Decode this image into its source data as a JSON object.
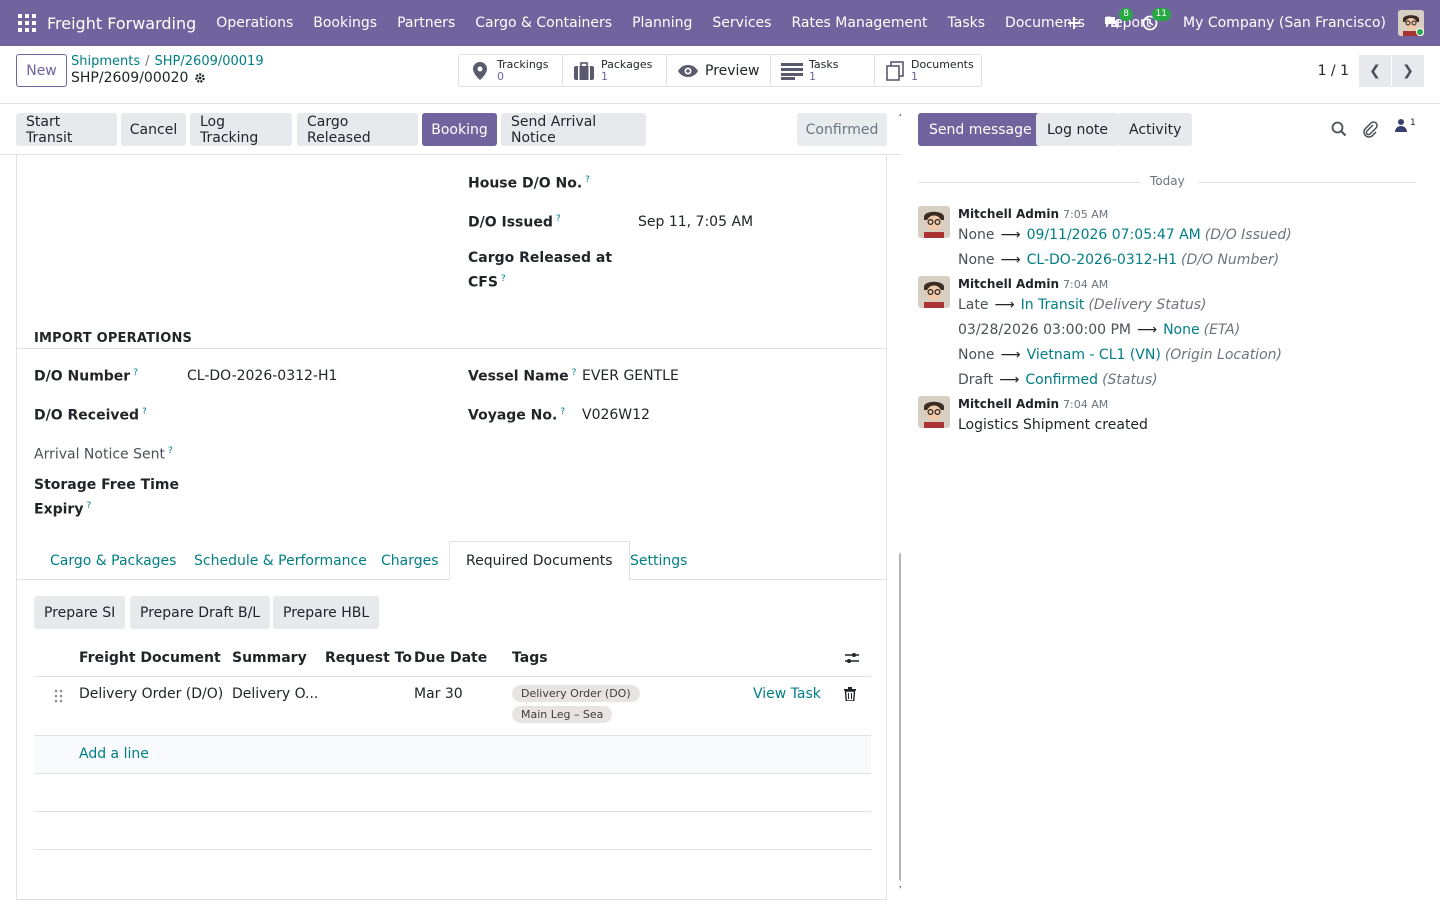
{
  "topbar": {
    "brand": "Freight Forwarding",
    "menu": [
      "Operations",
      "Bookings",
      "Partners",
      "Cargo & Containers",
      "Planning",
      "Services",
      "Rates Management",
      "Tasks",
      "Documents",
      "Report"
    ],
    "messages_count": "8",
    "activities_count": "11",
    "company": "My Company (San Francisco)"
  },
  "control": {
    "new_label": "New",
    "breadcrumb_parent": "Shipments",
    "breadcrumb_sep": "/",
    "breadcrumb_prev": "SHP/2609/00019",
    "current": "SHP/2609/00020",
    "smart_buttons": [
      {
        "label": "Trackings",
        "count": "0"
      },
      {
        "label": "Packages",
        "count": "1"
      },
      {
        "label": "Preview",
        "count": ""
      },
      {
        "label": "Tasks",
        "count": "1"
      },
      {
        "label": "Documents",
        "count": "1"
      }
    ],
    "pager": "1 / 1"
  },
  "statusbar": {
    "buttons": [
      "Start Transit",
      "Cancel",
      "Log Tracking",
      "Cargo Released",
      "Booking",
      "Send Arrival Notice"
    ],
    "status": "Confirmed"
  },
  "form": {
    "house_do_label": "House D/O No.",
    "do_issued_label": "D/O Issued",
    "do_issued_value": "Sep 11, 7:05 AM",
    "cargo_released_label_1": "Cargo Released at",
    "cargo_released_label_2": "CFS",
    "import_ops_title": "IMPORT OPERATIONS",
    "do_number_label": "D/O Number",
    "do_number_value": "CL-DO-2026-0312-H1",
    "do_received_label": "D/O Received",
    "arrival_notice_label": "Arrival Notice Sent",
    "storage_label_1": "Storage Free Time",
    "storage_label_2": "Expiry",
    "vessel_label": "Vessel Name",
    "vessel_value": "EVER GENTLE",
    "voyage_label": "Voyage No.",
    "voyage_value": "V026W12",
    "help": "?"
  },
  "tabs": [
    "Cargo & Packages",
    "Schedule & Performance",
    "Charges",
    "Required Documents",
    "Settings"
  ],
  "doc_buttons": [
    "Prepare SI",
    "Prepare Draft B/L",
    "Prepare HBL"
  ],
  "table": {
    "headers": [
      "Freight Document T...",
      "Summary",
      "Request To",
      "Due Date",
      "Tags"
    ],
    "row": {
      "document": "Delivery Order (D/O)",
      "summary": "Delivery O...",
      "request_to": "",
      "due": "Mar 30",
      "tags": [
        "Delivery Order (DO)",
        "Main Leg – Sea"
      ],
      "action": "View Task"
    },
    "add_line": "Add a line"
  },
  "chatter": {
    "send_message": "Send message",
    "log_note": "Log note",
    "activity": "Activity",
    "followers": "1",
    "today": "Today",
    "messages": [
      {
        "author": "Mitchell Admin",
        "time": "7:05 AM",
        "changes": [
          {
            "old": "None",
            "new": "09/11/2026 07:05:47 AM",
            "field": "(D/O Issued)"
          },
          {
            "old": "None",
            "new": "CL-DO-2026-0312-H1",
            "field": "(D/O Number)"
          }
        ]
      },
      {
        "author": "Mitchell Admin",
        "time": "7:04 AM",
        "changes": [
          {
            "old": "Late",
            "new": "In Transit",
            "field": "(Delivery Status)"
          },
          {
            "old": "03/28/2026 03:00:00 PM",
            "new": "None",
            "field": "(ETA)"
          },
          {
            "old": "None",
            "new": "Vietnam - CL1 (VN)",
            "field": "(Origin Location)"
          },
          {
            "old": "Draft",
            "new": "Confirmed",
            "field": "(Status)"
          }
        ]
      },
      {
        "author": "Mitchell Admin",
        "time": "7:04 AM",
        "text": "Logistics Shipment created"
      }
    ]
  }
}
